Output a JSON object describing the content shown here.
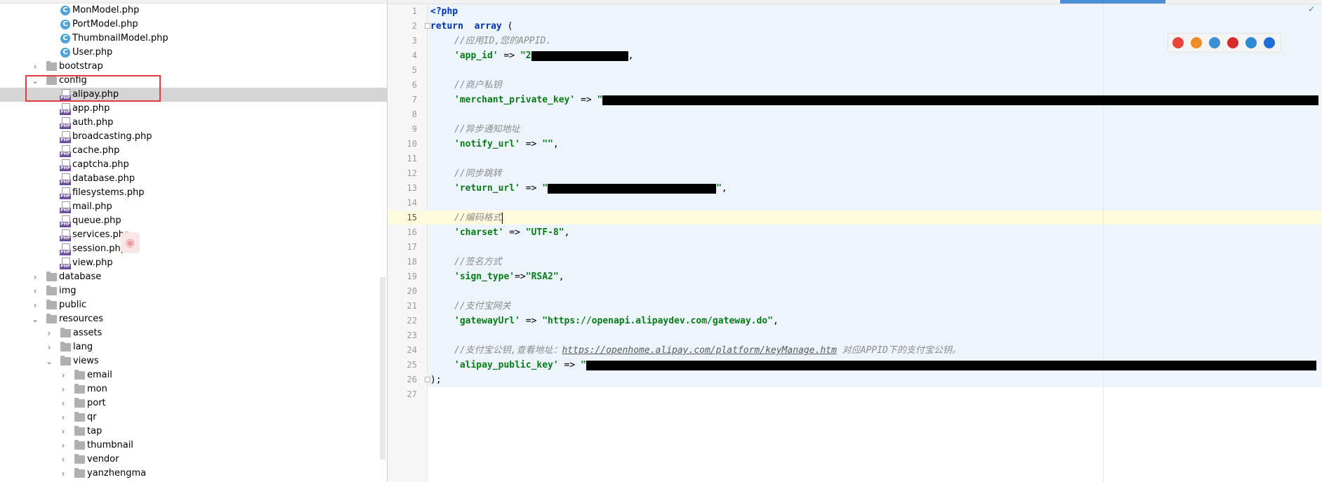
{
  "project_tree": {
    "items": [
      {
        "label": "MonModel.php",
        "type": "class",
        "indent": 3
      },
      {
        "label": "PortModel.php",
        "type": "class",
        "indent": 3
      },
      {
        "label": "ThumbnailModel.php",
        "type": "class",
        "indent": 3
      },
      {
        "label": "User.php",
        "type": "class",
        "indent": 3
      },
      {
        "label": "bootstrap",
        "type": "folder",
        "indent": 1,
        "expanded": false
      },
      {
        "label": "config",
        "type": "folder",
        "indent": 1,
        "expanded": true
      },
      {
        "label": "alipay.php",
        "type": "php",
        "indent": 3,
        "selected": true
      },
      {
        "label": "app.php",
        "type": "php",
        "indent": 3
      },
      {
        "label": "auth.php",
        "type": "php",
        "indent": 3
      },
      {
        "label": "broadcasting.php",
        "type": "php",
        "indent": 3
      },
      {
        "label": "cache.php",
        "type": "php",
        "indent": 3
      },
      {
        "label": "captcha.php",
        "type": "php",
        "indent": 3
      },
      {
        "label": "database.php",
        "type": "php",
        "indent": 3
      },
      {
        "label": "filesystems.php",
        "type": "php",
        "indent": 3
      },
      {
        "label": "mail.php",
        "type": "php",
        "indent": 3
      },
      {
        "label": "queue.php",
        "type": "php",
        "indent": 3
      },
      {
        "label": "services.php",
        "type": "php",
        "indent": 3
      },
      {
        "label": "session.php",
        "type": "php",
        "indent": 3
      },
      {
        "label": "view.php",
        "type": "php",
        "indent": 3
      },
      {
        "label": "database",
        "type": "folder",
        "indent": 1,
        "expanded": false
      },
      {
        "label": "img",
        "type": "folder",
        "indent": 1,
        "expanded": false
      },
      {
        "label": "public",
        "type": "folder",
        "indent": 1,
        "expanded": false
      },
      {
        "label": "resources",
        "type": "folder",
        "indent": 1,
        "expanded": true
      },
      {
        "label": "assets",
        "type": "folder",
        "indent": 2,
        "expanded": false
      },
      {
        "label": "lang",
        "type": "folder",
        "indent": 2,
        "expanded": false
      },
      {
        "label": "views",
        "type": "folder",
        "indent": 2,
        "expanded": true
      },
      {
        "label": "email",
        "type": "folder",
        "indent": 3,
        "expanded": false
      },
      {
        "label": "mon",
        "type": "folder",
        "indent": 3,
        "expanded": false
      },
      {
        "label": "port",
        "type": "folder",
        "indent": 3,
        "expanded": false
      },
      {
        "label": "qr",
        "type": "folder",
        "indent": 3,
        "expanded": false
      },
      {
        "label": "tap",
        "type": "folder",
        "indent": 3,
        "expanded": false
      },
      {
        "label": "thumbnail",
        "type": "folder",
        "indent": 3,
        "expanded": false
      },
      {
        "label": "vendor",
        "type": "folder",
        "indent": 3,
        "expanded": false
      },
      {
        "label": "yanzhengma",
        "type": "folder",
        "indent": 3,
        "expanded": false
      }
    ]
  },
  "editor": {
    "line_numbers": [
      "1",
      "2",
      "3",
      "4",
      "5",
      "6",
      "7",
      "8",
      "9",
      "10",
      "11",
      "12",
      "13",
      "14",
      "15",
      "16",
      "17",
      "18",
      "19",
      "20",
      "21",
      "22",
      "23",
      "24",
      "25",
      "26",
      "27"
    ],
    "current_line": "15",
    "code": {
      "l1": "<?php",
      "l2_kw": "return",
      "l2_arr": "array",
      "l2_paren": " (",
      "l3": "//应用ID,您的APPID.",
      "l4_key": "'app_id'",
      "l4_arrow": " => ",
      "l4_val": "\"2",
      "l4_tail": ",",
      "l6": "//商户私钥",
      "l7_key": "'merchant_private_key'",
      "l7_arrow": " => ",
      "l7_val": "\"",
      "l9": "//异步通知地址",
      "l10_key": "'notify_url'",
      "l10_arrow": " => ",
      "l10_val": "\"\"",
      "l10_tail": ",",
      "l12": "//同步跳转",
      "l13_key": "'return_url'",
      "l13_arrow": " => ",
      "l13_val": "\"",
      "l13_end": "\"",
      "l13_tail": ",",
      "l15": "//编码格式",
      "l16_key": "'charset'",
      "l16_arrow": " => ",
      "l16_val": "\"UTF-8\"",
      "l16_tail": ",",
      "l18": "//签名方式",
      "l19_key": "'sign_type'",
      "l19_arrow": "=>",
      "l19_val": "\"RSA2\"",
      "l19_tail": ",",
      "l21": "//支付宝网关",
      "l22_key": "'gatewayUrl'",
      "l22_arrow": " => ",
      "l22_val": "\"https://openapi.alipaydev.com/gateway.do\"",
      "l22_tail": ",",
      "l24_a": "//支付宝公钥,查看地址：",
      "l24_url": "https://openhome.alipay.com/platform/keyManage.htm",
      "l24_b": " 对应APPID下的支付宝公钥。",
      "l25_key": "'alipay_public_key'",
      "l25_arrow": " => ",
      "l25_val": "\"",
      "l26": ");"
    }
  },
  "browser_icons": [
    "chrome-icon",
    "firefox-icon",
    "safari-icon",
    "opera-icon",
    "ie-icon",
    "edge-icon"
  ],
  "colors": {
    "keyword": "#0033b3",
    "string": "#067d17",
    "comment": "#8c8c8c",
    "selection_box": "#e13b3b",
    "current_line": "#fffbdd"
  }
}
